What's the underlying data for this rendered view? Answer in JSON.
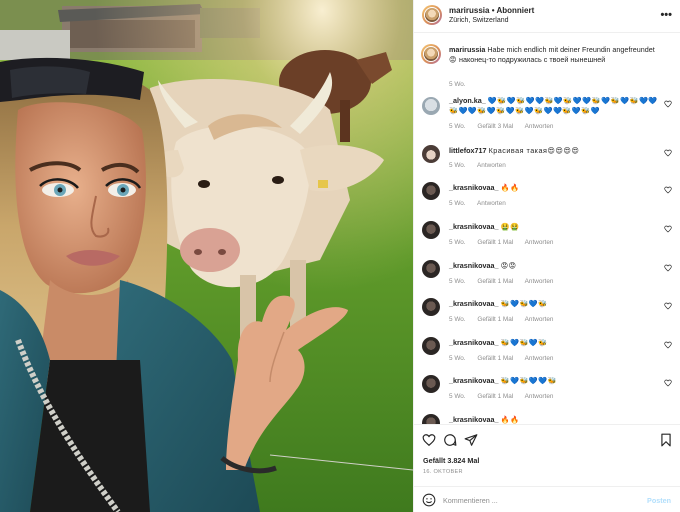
{
  "post": {
    "username": "marirussia",
    "separator": "•",
    "follow_state": "Abonniert",
    "location": "Zürich, Switzerland",
    "more_icon": "more-horizontal-icon",
    "caption": {
      "username": "marirussia",
      "text_de": "Habe mich endlich mit deiner Freundin angefreundet",
      "emoji": "😡",
      "text_ru": "наконец-то подружилась с твоей нынешней",
      "time": "5 Wo."
    },
    "photo_alt_icon": "selfie-with-cow-photo"
  },
  "comments": [
    {
      "username": "_alyon.ka_",
      "text": "💙🐝💙🐝💙💙🐝💙🐝💙💙🐝💙🐝💙🐝💙💙🐝💙💙🐝💙🐝💙🐝💙🐝💙💙🐝💙🐝💙",
      "time": "5 Wo.",
      "likes": "Gefällt 3 Mal",
      "reply": "Antworten",
      "avatar": "alyon"
    },
    {
      "username": "littlefox717",
      "text": "Красивая такая😍😍😍😍",
      "time": "5 Wo.",
      "likes": "",
      "reply": "Antworten",
      "avatar": "little"
    },
    {
      "username": "_krasnikovaa_",
      "text": "🔥🔥",
      "time": "5 Wo.",
      "likes": "",
      "reply": "Antworten",
      "avatar": "dark"
    },
    {
      "username": "_krasnikovaa_",
      "text": "🤮🤮",
      "time": "5 Wo.",
      "likes": "Gefällt 1 Mal",
      "reply": "Antworten",
      "avatar": "dark"
    },
    {
      "username": "_krasnikovaa_",
      "text": "😡😡",
      "time": "5 Wo.",
      "likes": "Gefällt 1 Mal",
      "reply": "Antworten",
      "avatar": "dark"
    },
    {
      "username": "_krasnikovaa_",
      "text": "🐝💙🐝💙🐝",
      "time": "5 Wo.",
      "likes": "Gefällt 1 Mal",
      "reply": "Antworten",
      "avatar": "dark"
    },
    {
      "username": "_krasnikovaa_",
      "text": "🐝💙🐝💙🐝",
      "time": "5 Wo.",
      "likes": "Gefällt 1 Mal",
      "reply": "Antworten",
      "avatar": "dark"
    },
    {
      "username": "_krasnikovaa_",
      "text": "🐝💙🐝💙💙🐝",
      "time": "5 Wo.",
      "likes": "Gefällt 1 Mal",
      "reply": "Antworten",
      "avatar": "dark"
    },
    {
      "username": "_krasnikovaa_",
      "text": "🔥🔥",
      "time": "",
      "likes": "",
      "reply": "",
      "avatar": "dark"
    }
  ],
  "actions": {
    "like_icon": "heart-icon",
    "comment_icon": "comment-icon",
    "share_icon": "share-icon",
    "save_icon": "bookmark-icon",
    "likes_text": "Gefällt 3.824 Mal",
    "date": "16. OKTOBER"
  },
  "add_comment": {
    "placeholder": "Kommentieren ...",
    "post_label": "Posten",
    "emoji_icon": "smiley-icon"
  },
  "colors": {
    "text": "#262626",
    "muted": "#8e8e8e",
    "border": "#efefef",
    "post_disabled": "#b2dffc"
  }
}
